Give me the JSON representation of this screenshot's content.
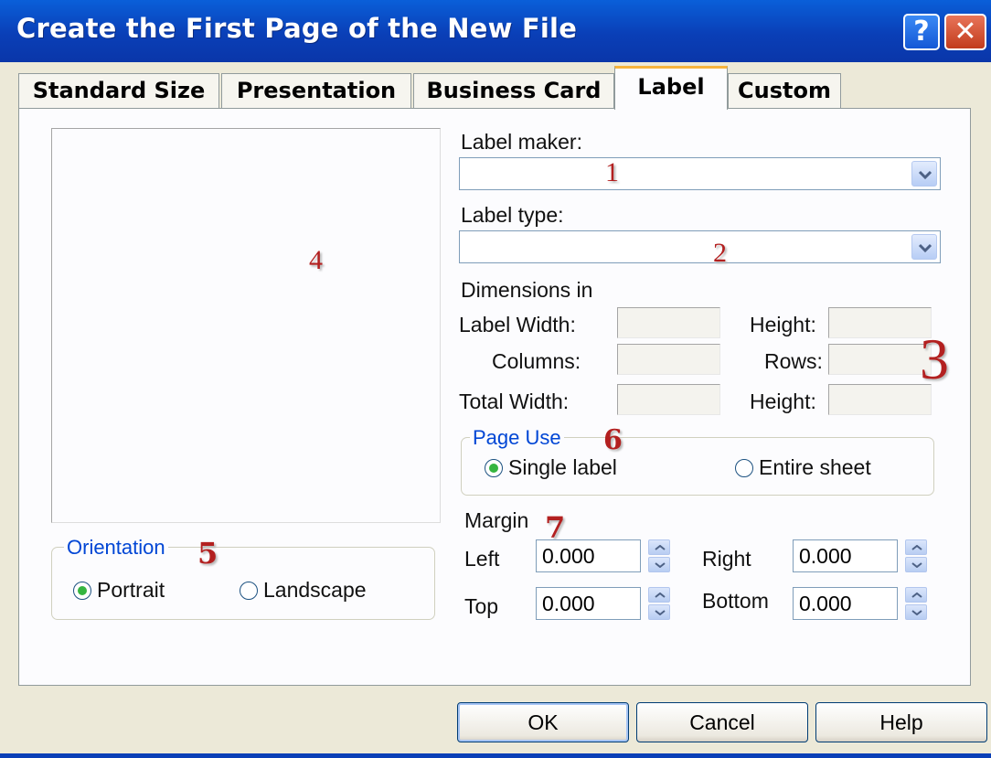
{
  "window": {
    "title": "Create the First Page of the New File",
    "help_glyph": "?",
    "close_glyph": "✕"
  },
  "tabs": [
    {
      "label": "Standard Size",
      "active": false
    },
    {
      "label": "Presentation",
      "active": false
    },
    {
      "label": "Business Card",
      "active": false
    },
    {
      "label": "Label",
      "active": true
    },
    {
      "label": "Custom",
      "active": false
    }
  ],
  "form": {
    "label_maker_label": "Label maker:",
    "label_maker_value": "",
    "label_type_label": "Label type:",
    "label_type_value": "",
    "dimensions_label": "Dimensions in",
    "label_width_label": "Label Width:",
    "label_height_label": "Height:",
    "columns_label": "Columns:",
    "rows_label": "Rows:",
    "total_width_label": "Total Width:",
    "total_height_label": "Height:"
  },
  "page_use": {
    "legend": "Page Use",
    "options": [
      {
        "label": "Single label",
        "selected": true
      },
      {
        "label": "Entire sheet",
        "selected": false
      }
    ]
  },
  "margin": {
    "label": "Margin",
    "left_label": "Left",
    "left_value": "0.000",
    "right_label": "Right",
    "right_value": "0.000",
    "top_label": "Top",
    "top_value": "0.000",
    "bottom_label": "Bottom",
    "bottom_value": "0.000"
  },
  "orientation": {
    "legend": "Orientation",
    "options": [
      {
        "label": "Portrait",
        "selected": true
      },
      {
        "label": "Landscape",
        "selected": false
      }
    ]
  },
  "buttons": {
    "ok": "OK",
    "cancel": "Cancel",
    "help": "Help"
  },
  "annotations": {
    "a1": "1",
    "a2": "2",
    "a3": "3",
    "a4": "4",
    "a5": "5",
    "a6": "6",
    "a7": "7"
  },
  "colors": {
    "title_bar": "#0a3fb7",
    "tab_highlight": "#f6b43d",
    "legend_text": "#0046d5",
    "annotation": "#b32020",
    "radio_dot": "#35b540"
  }
}
